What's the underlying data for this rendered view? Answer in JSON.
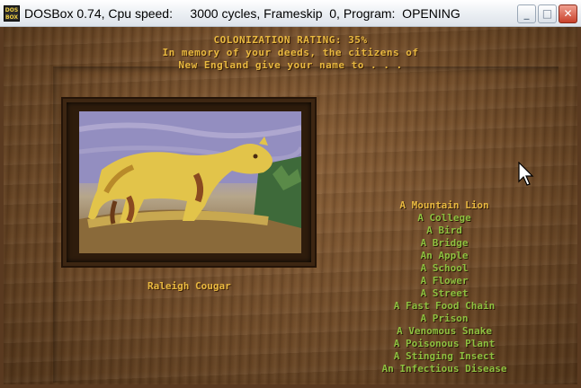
{
  "window": {
    "title": "DOSBox 0.74, Cpu speed:     3000 cycles, Frameskip  0, Program:  OPENING",
    "icon_label": "DOS BOX",
    "controls": {
      "minimize": "_",
      "maximize": "□",
      "close": "✕"
    }
  },
  "game": {
    "header": {
      "rating_line": "COLONIZATION RATING: 35%",
      "line2": "In memory of your deeds, the citizens of",
      "line3": "New England give your name to . . ."
    },
    "caption": "Raleigh Cougar",
    "options": [
      "A Mountain Lion",
      "A College",
      "A Bird",
      "A Bridge",
      "An Apple",
      "A School",
      "A Flower",
      "A Street",
      "A Fast Food Chain",
      "A Prison",
      "A Venomous Snake",
      "A Poisonous Plant",
      "A Stinging Insect",
      "An Infectious Disease"
    ],
    "selected_index": 0
  },
  "colors": {
    "header_text": "#e8b840",
    "option_text": "#8ec040",
    "selected_option": "#e8b840",
    "wood": "#7a5230"
  },
  "icons": {
    "app_icon": "dosbox-icon",
    "cursor": "mouse-pointer-icon"
  }
}
